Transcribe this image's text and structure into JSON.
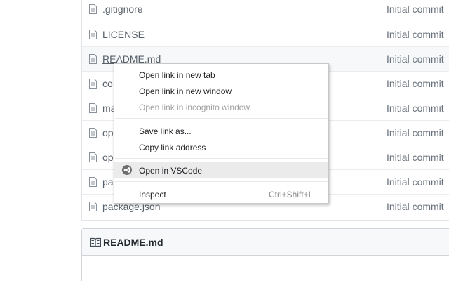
{
  "files": [
    {
      "name": ".gitignore",
      "commit": "Initial commit"
    },
    {
      "name": "LICENSE",
      "commit": "Initial commit"
    },
    {
      "name": "README.md",
      "commit": "Initial commit"
    },
    {
      "name": "co",
      "commit": "Initial commit"
    },
    {
      "name": "ma",
      "commit": "Initial commit"
    },
    {
      "name": "op",
      "commit": "Initial commit"
    },
    {
      "name": "op",
      "commit": "Initial commit"
    },
    {
      "name": "pa",
      "commit": "Initial commit"
    },
    {
      "name": "package.json",
      "commit": "Initial commit"
    }
  ],
  "readme": {
    "title": "README.md",
    "icon": "book-icon"
  },
  "context_menu": {
    "open_new_tab": "Open link in new tab",
    "open_new_window": "Open link in new window",
    "open_incognito": "Open link in incognito window",
    "save_link_as": "Save link as...",
    "copy_link_address": "Copy link address",
    "open_in_vscode": "Open in VSCode",
    "inspect": "Inspect",
    "inspect_shortcut": "Ctrl+Shift+I"
  },
  "colors": {
    "link_text": "#586069",
    "commit_text": "#6a737d",
    "menu_highlight": "#ebebeb",
    "vscode_icon": "#6e6e6e"
  }
}
